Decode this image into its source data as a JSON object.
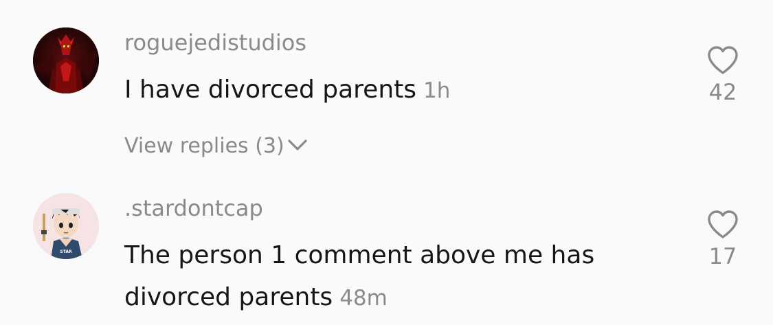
{
  "comments": [
    {
      "username": "roguejedistudios",
      "text": "I have divorced parents",
      "time": "1h",
      "likes": "42",
      "view_replies": "View replies (3)",
      "avatar_icon": "red-masked-figure-avatar"
    },
    {
      "username": ".stardontcap",
      "text": "The person 1 comment above me has divorced parents",
      "time": "48m",
      "likes": "17",
      "avatar_icon": "anime-boy-avatar",
      "avatar_badge": "STAR"
    }
  ],
  "colors": {
    "background": "#fafafa",
    "text_primary": "#161616",
    "text_secondary": "#8a8a8a"
  }
}
